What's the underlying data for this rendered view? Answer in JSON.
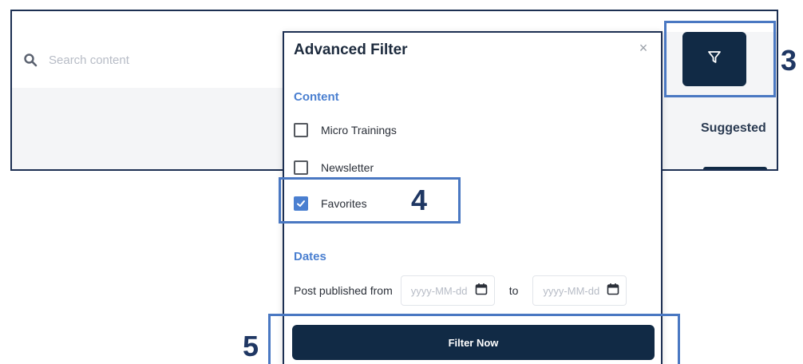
{
  "search": {
    "placeholder": "Search content",
    "icon": "search-icon"
  },
  "toolbar": {
    "filter_icon": "filter-icon"
  },
  "suggested": {
    "label": "Suggested"
  },
  "advanced_filter": {
    "title": "Advanced Filter",
    "close_symbol": "×",
    "content_section": {
      "label": "Content",
      "options": [
        {
          "label": "Micro Trainings",
          "checked": false
        },
        {
          "label": "Newsletter",
          "checked": false
        },
        {
          "label": "Favorites",
          "checked": true
        }
      ]
    },
    "dates_section": {
      "label": "Dates",
      "from_label": "Post published from",
      "from_placeholder": "yyyy-MM-dd",
      "to_label": "to",
      "to_placeholder": "yyyy-MM-dd"
    },
    "submit_label": "Filter Now"
  },
  "annotations": {
    "step_3": "3",
    "step_4": "4",
    "step_5": "5"
  },
  "colors": {
    "primary_dark": "#112a45",
    "accent_blue": "#4a7fd0",
    "annotation_blue": "#4a78c2"
  }
}
